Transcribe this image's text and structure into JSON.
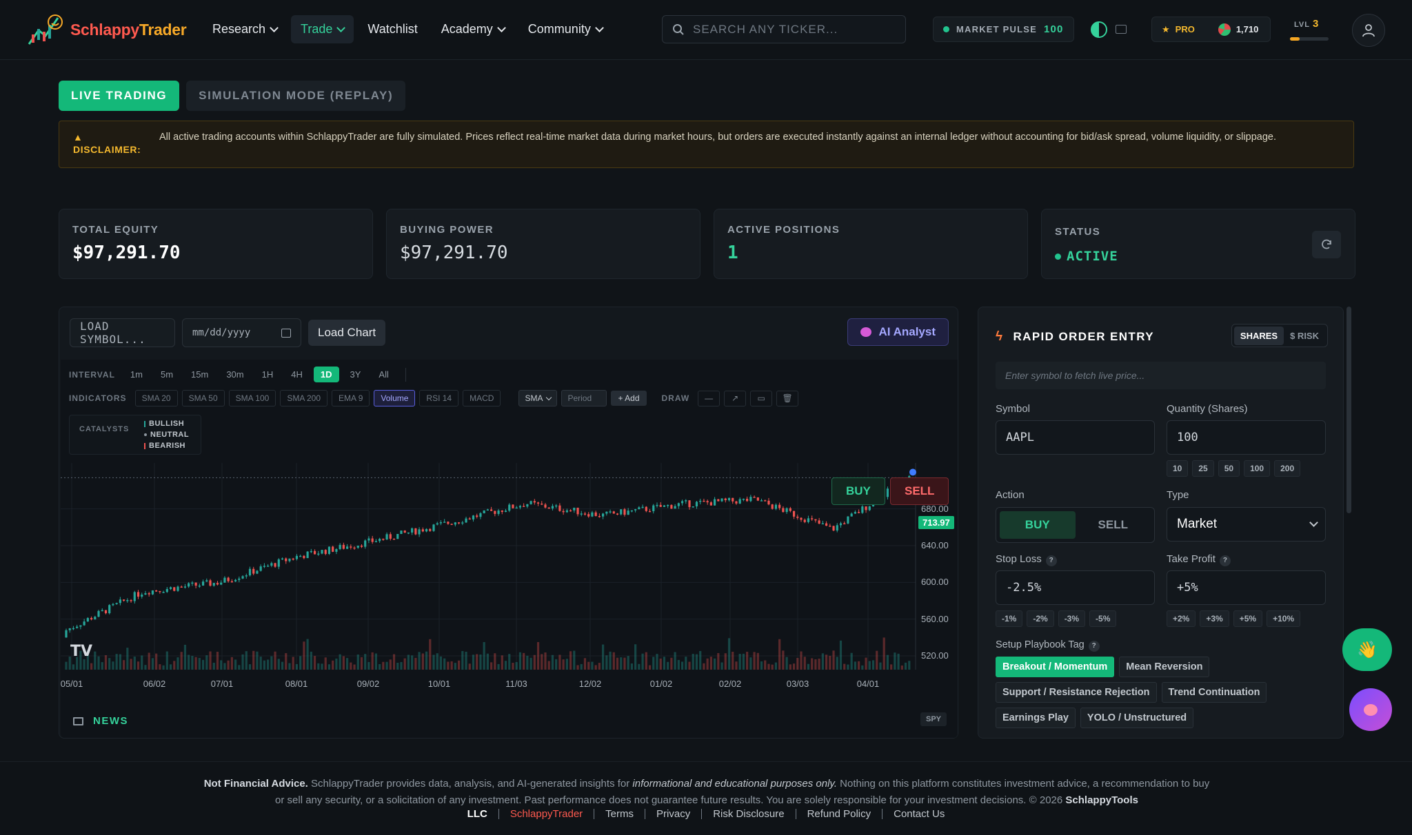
{
  "brand": {
    "name_a": "Schlappy",
    "name_b": "Trader"
  },
  "nav": {
    "items": [
      {
        "label": "Research",
        "dropdown": true
      },
      {
        "label": "Trade",
        "dropdown": true,
        "active": true
      },
      {
        "label": "Watchlist",
        "dropdown": false
      },
      {
        "label": "Academy",
        "dropdown": true
      },
      {
        "label": "Community",
        "dropdown": true
      }
    ]
  },
  "search": {
    "placeholder": "SEARCH ANY TICKER..."
  },
  "market_pulse": {
    "label": "MARKET PULSE",
    "value": "100"
  },
  "pro": {
    "label": "PRO",
    "coins": "1,710"
  },
  "level": {
    "label": "LVL",
    "value": "3",
    "progress": 0.25
  },
  "modes": {
    "live": "LIVE TRADING",
    "sim": "SIMULATION MODE (REPLAY)"
  },
  "disclaimer": {
    "label": "DISCLAIMER:",
    "text": "All active trading accounts within SchlappyTrader are fully simulated. Prices reflect real-time market data during market hours, but orders are executed instantly against an internal ledger without accounting for bid/ask spread, volume liquidity, or slippage."
  },
  "stats": {
    "equity": {
      "label": "TOTAL EQUITY",
      "value": "$97,291.70"
    },
    "buying_power": {
      "label": "BUYING POWER",
      "value": "$97,291.70"
    },
    "positions": {
      "label": "ACTIVE POSITIONS",
      "value": "1"
    },
    "status": {
      "label": "STATUS",
      "value": "ACTIVE"
    }
  },
  "chart_toolbar": {
    "symbol_placeholder": "LOAD SYMBOL...",
    "date_placeholder": "mm/dd/yyyy",
    "load_label": "Load Chart",
    "ai_label": "AI Analyst",
    "interval_label": "INTERVAL",
    "intervals": [
      "1m",
      "5m",
      "15m",
      "30m",
      "1H",
      "4H",
      "1D",
      "3Y",
      "All"
    ],
    "active_interval": "1D",
    "indicators_label": "INDICATORS",
    "indicators": [
      "SMA 20",
      "SMA 50",
      "SMA 100",
      "SMA 200",
      "EMA 9",
      "Volume",
      "RSI 14",
      "MACD"
    ],
    "active_indicator": "Volume",
    "ma_type": "SMA",
    "period_placeholder": "Period",
    "add_label": "+ Add",
    "draw_label": "DRAW"
  },
  "catalysts": {
    "label": "CATALYSTS",
    "bullish": "BULLISH",
    "neutral": "NEUTRAL",
    "bearish": "BEARISH"
  },
  "chart": {
    "buy_label": "BUY",
    "sell_label": "SELL",
    "last_price": "713.97",
    "y_ticks": [
      "680.00",
      "640.00",
      "600.00",
      "560.00",
      "520.00"
    ],
    "x_ticks": [
      "05/01",
      "06/02",
      "07/01",
      "08/01",
      "09/02",
      "10/01",
      "11/03",
      "12/02",
      "01/02",
      "02/02",
      "03/03",
      "04/01"
    ],
    "tv_logo": "TV",
    "up_color": "#26a69a",
    "down_color": "#ef5350"
  },
  "chart_data": {
    "type": "candlestick",
    "x": [
      "05/01",
      "06/02",
      "07/01",
      "08/01",
      "09/02",
      "10/01",
      "11/03",
      "12/02",
      "01/02",
      "02/02",
      "03/03",
      "04/01"
    ],
    "close_approx": [
      548,
      590,
      600,
      628,
      645,
      665,
      686,
      673,
      685,
      690,
      658,
      714
    ],
    "ylim": [
      505,
      730
    ],
    "last": 713.97
  },
  "news": {
    "label": "NEWS",
    "ticker": "SPY"
  },
  "order": {
    "title": "RAPID ORDER ENTRY",
    "mode_shares": "SHARES",
    "mode_risk": "$ RISK",
    "symbol_prompt": "Enter symbol to fetch live price...",
    "symbol_label": "Symbol",
    "symbol_value": "AAPL",
    "qty_label": "Quantity (Shares)",
    "qty_value": "100",
    "qty_presets": [
      "10",
      "25",
      "50",
      "100",
      "200"
    ],
    "action_label": "Action",
    "buy": "BUY",
    "sell": "SELL",
    "type_label": "Type",
    "type_value": "Market",
    "sl_label": "Stop Loss",
    "sl_value": "-2.5%",
    "sl_presets": [
      "-1%",
      "-2%",
      "-3%",
      "-5%"
    ],
    "tp_label": "Take Profit",
    "tp_value": "+5%",
    "tp_presets": [
      "+2%",
      "+3%",
      "+5%",
      "+10%"
    ],
    "help": "?",
    "playbook_label": "Setup Playbook Tag",
    "tags": [
      "Breakout / Momentum",
      "Mean Reversion",
      "Support / Resistance Rejection",
      "Trend Continuation",
      "Earnings Play",
      "YOLO / Unstructured"
    ],
    "active_tag": "Breakout / Momentum"
  },
  "footer": {
    "lead": "Not Financial Advice.",
    "text1": " SchlappyTrader provides data, analysis, and AI-generated insights for ",
    "em": "informational and educational purposes only.",
    "text2": " Nothing on this platform constitutes investment advice, a recommendation to buy or sell any security, or a solicitation of any investment. Past performance does not guarantee future results. You are solely responsible for your investment decisions. © 2026 ",
    "company": "SchlappyTools",
    "llc": "LLC",
    "links": [
      "SchlappyTrader",
      "Terms",
      "Privacy",
      "Risk Disclosure",
      "Refund Policy",
      "Contact Us"
    ]
  }
}
